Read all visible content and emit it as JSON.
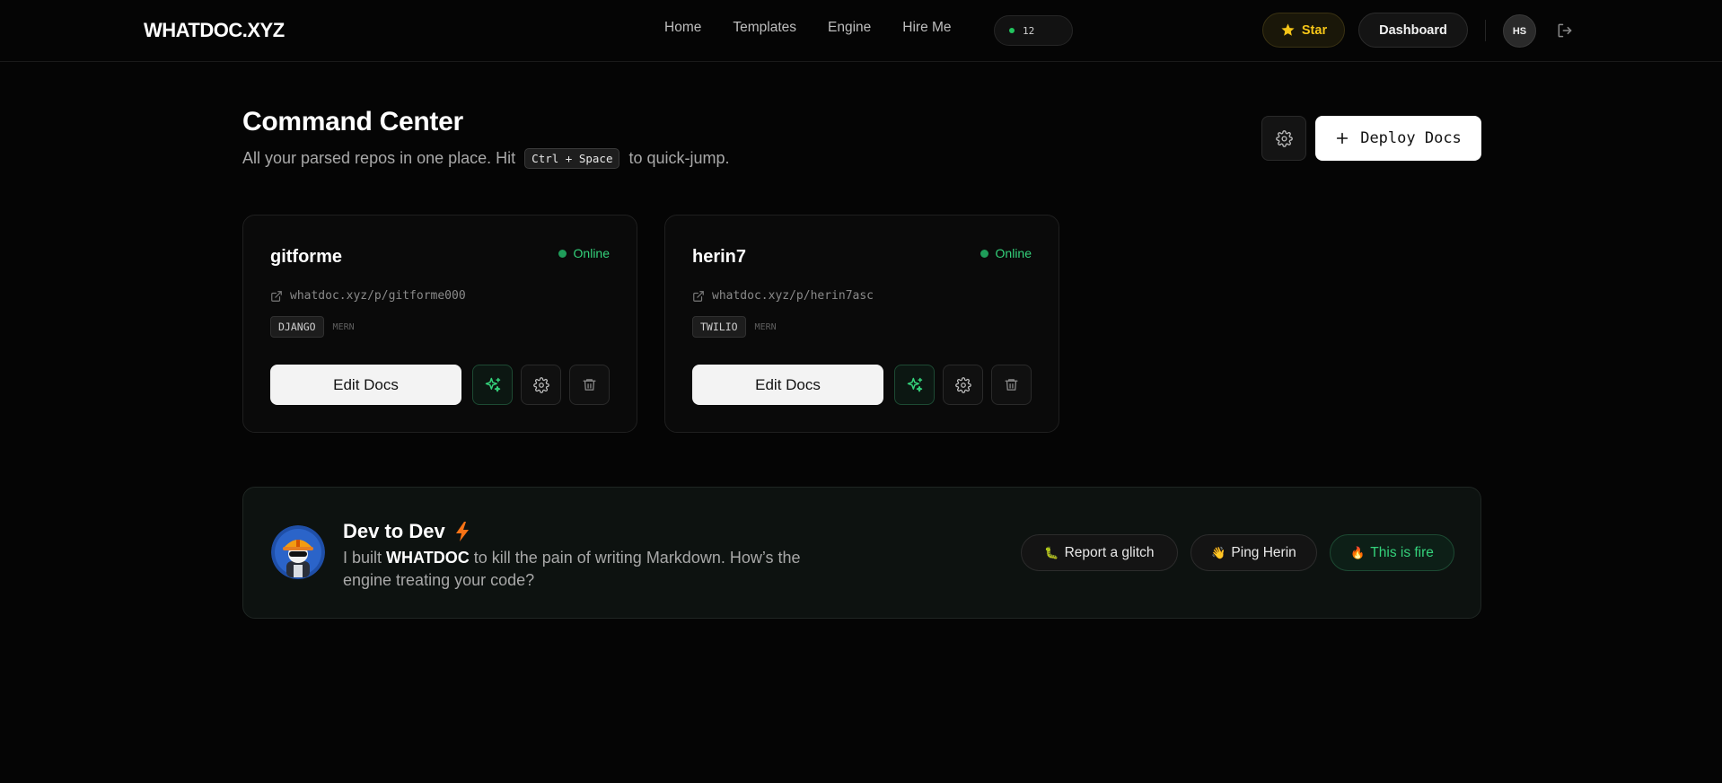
{
  "brand": {
    "logo": "WHATDOC.XYZ"
  },
  "nav": {
    "items": [
      "Home",
      "Templates",
      "Engine",
      "Hire Me"
    ],
    "live_count": "12"
  },
  "header_actions": {
    "star_label": "Star",
    "dashboard_label": "Dashboard",
    "avatar_initials": "HS"
  },
  "page": {
    "title": "Command Center",
    "subtitle_before": "All your parsed repos in one place. Hit",
    "shortcut": "Ctrl + Space",
    "subtitle_after": "to quick-jump.",
    "deploy_label": "Deploy Docs"
  },
  "projects": [
    {
      "name": "gitforme",
      "status": "Online",
      "url": "whatdoc.xyz/p/gitforme000",
      "tag": "DJANGO",
      "stack": "MERN",
      "edit_label": "Edit Docs"
    },
    {
      "name": "herin7",
      "status": "Online",
      "url": "whatdoc.xyz/p/herin7asc",
      "tag": "TWILIO",
      "stack": "MERN",
      "edit_label": "Edit Docs"
    }
  ],
  "banner": {
    "title": "Dev to Dev",
    "text_before": "I built",
    "brand_word": "WHATDOC",
    "text_after": "to kill the pain of writing Markdown. How’s the engine treating your code?",
    "buttons": [
      {
        "emoji": "🐛",
        "label": "Report a glitch"
      },
      {
        "emoji": "👋",
        "label": "Ping Herin"
      },
      {
        "emoji": "🔥",
        "label": "This is fire"
      }
    ]
  },
  "colors": {
    "accent_green": "#34d27b",
    "star_yellow": "#f5c518",
    "lightning_orange": "#f97316"
  }
}
